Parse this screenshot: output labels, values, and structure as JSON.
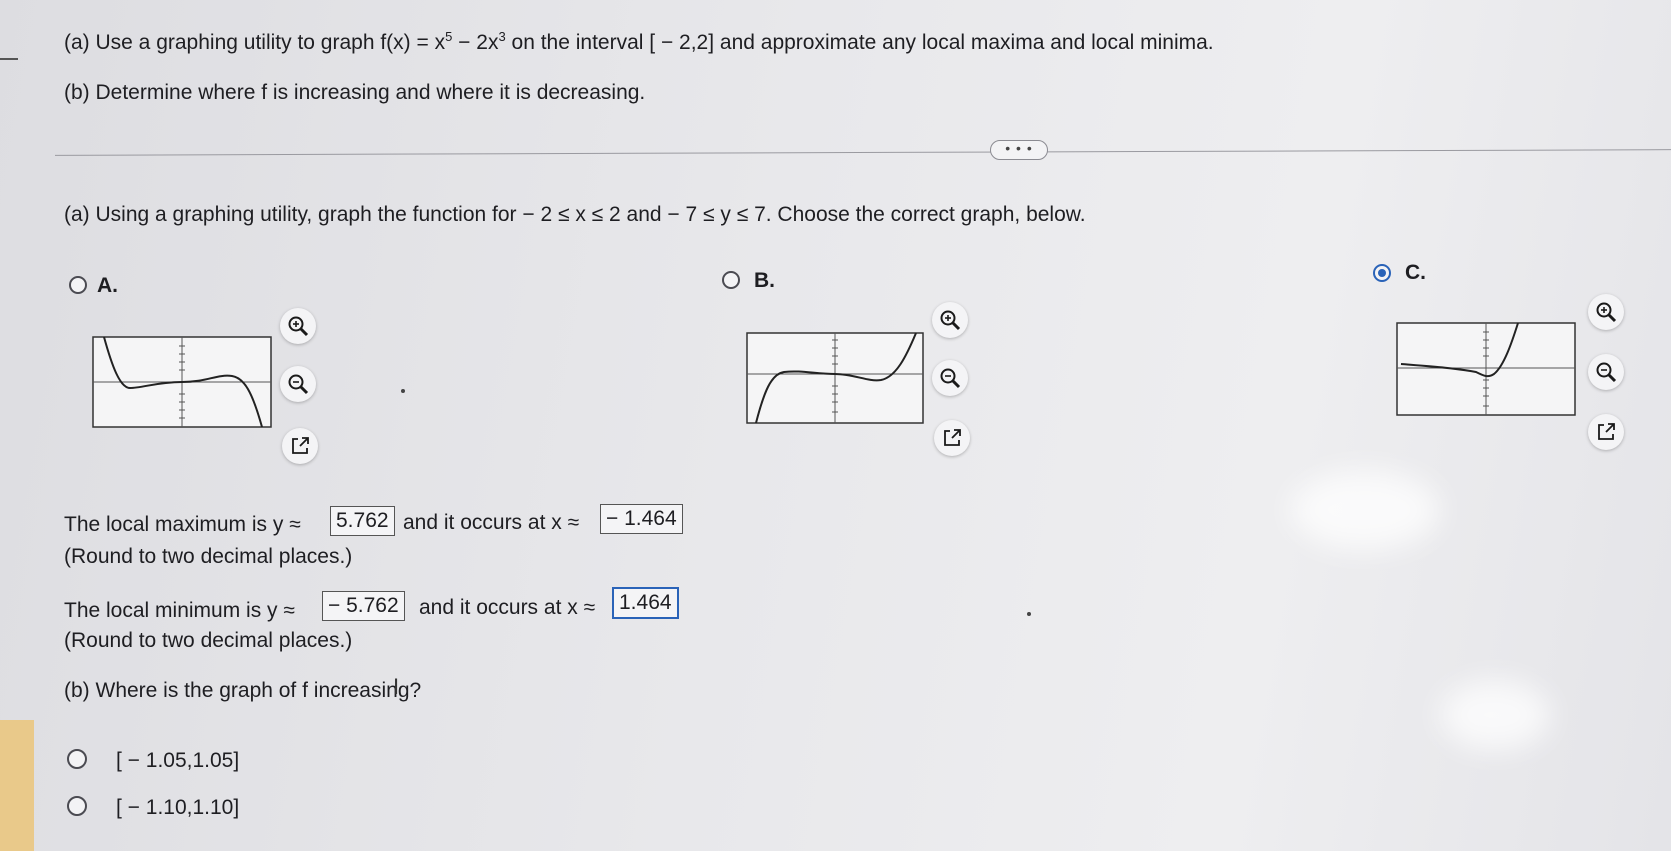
{
  "question": {
    "part_a_prefix": "(a) Use a graphing utility to graph f(x) = x",
    "exp1": "5",
    "mid": " − 2x",
    "exp2": "3",
    "part_a_suffix": " on the interval [ − 2,2] and approximate any local maxima and local minima.",
    "part_b": "(b) Determine where f is increasing and where it is decreasing."
  },
  "more_button": "• • •",
  "part_a_instruction": "(a) Using a graphing utility, graph the function for  − 2 ≤ x ≤ 2 and  − 7 ≤ y ≤ 7.  Choose the correct graph, below.",
  "graph_options": [
    {
      "label": "A.",
      "selected": false
    },
    {
      "label": "B.",
      "selected": false
    },
    {
      "label": "C.",
      "selected": true
    }
  ],
  "icons": {
    "zoom_in": "zoom-in-icon",
    "zoom_out": "zoom-out-icon",
    "popout": "external-link-icon"
  },
  "local_max": {
    "prefix": "The local maximum is y ≈",
    "y_value": "5.762",
    "middle": "and it occurs at x ≈",
    "x_value": " − 1.464",
    "note": "(Round to two decimal places.)"
  },
  "local_min": {
    "prefix": "The local minimum is y ≈",
    "y_value": " − 5.762",
    "middle": "and it occurs at x ≈",
    "x_value": "1.464",
    "note": "(Round to two decimal places.)"
  },
  "part_b_question": "(b) Where is the graph of f increasing?",
  "increasing_choices": [
    "[ − 1.05,1.05]",
    "[ − 1.10,1.10]"
  ],
  "colors": {
    "accent": "#2a63b8",
    "text": "#1e1e22",
    "left_bar": "#e9c98a"
  }
}
